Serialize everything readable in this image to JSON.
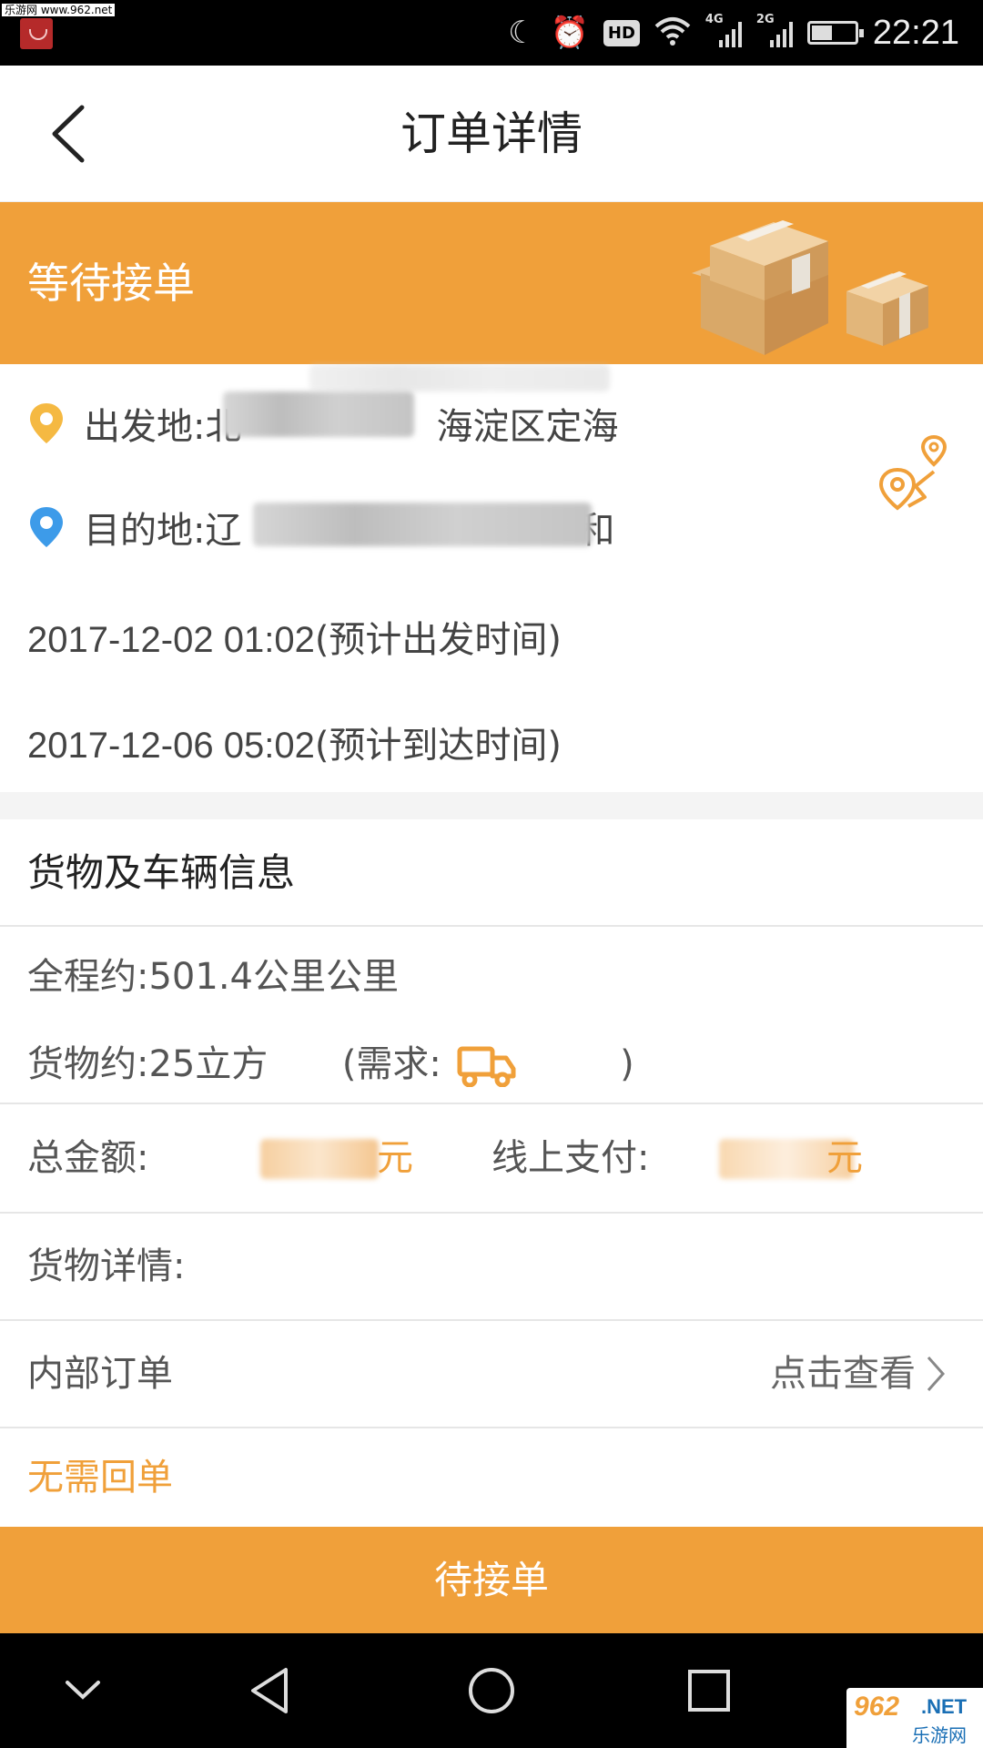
{
  "status_bar": {
    "watermark": "乐游网 www.962.net",
    "network_1": "4G",
    "network_2": "2G",
    "hd": "HD",
    "time": "22:21"
  },
  "header": {
    "title": "订单详情"
  },
  "banner": {
    "status": "等待接单",
    "color": "#f0a03a"
  },
  "route": {
    "origin_prefix": "出发地:北",
    "origin_suffix": "海淀区定海",
    "destination_prefix": "目的地:辽",
    "destination_suffix": "和",
    "departure_time": "2017-12-02 01:02",
    "departure_note": "(预计出发时间)",
    "arrival_time": "2017-12-06 05:02",
    "arrival_note": "(预计到达时间)"
  },
  "cargo": {
    "section_title": "货物及车辆信息",
    "distance": "全程约:501.4公里公里",
    "volume": "货物约:25立方",
    "requirement_open": "(需求:",
    "requirement_close": ")",
    "total_label": "总金额:",
    "total_value_suffix": "元",
    "online_label": "线上支付:",
    "online_value_suffix": "元",
    "detail_label": "货物详情:",
    "internal_label": "内部订单",
    "internal_link": "点击查看",
    "receipt_status": "无需回单"
  },
  "action": {
    "button_label": "待接单"
  },
  "watermark_logo": {
    "number": "962",
    "tld": ".NET",
    "name": "乐游网"
  }
}
